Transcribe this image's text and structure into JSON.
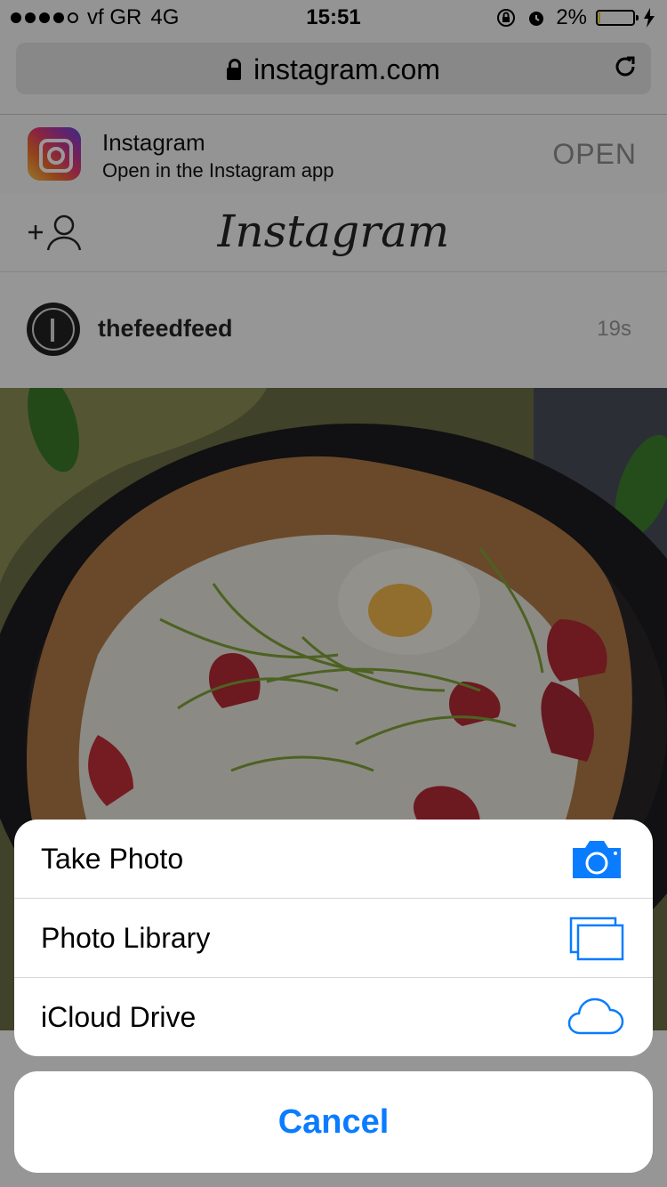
{
  "status_bar": {
    "carrier": "vf GR",
    "network": "4G",
    "time": "15:51",
    "battery": "2%"
  },
  "browser": {
    "url": "instagram.com"
  },
  "app_banner": {
    "title": "Instagram",
    "subtitle": "Open in the Instagram app",
    "open_label": "OPEN"
  },
  "ig_header": {
    "logo": "Instagram"
  },
  "post": {
    "username": "thefeedfeed",
    "time": "19s"
  },
  "action_sheet": {
    "items": [
      {
        "label": "Take Photo",
        "icon": "camera-icon"
      },
      {
        "label": "Photo Library",
        "icon": "photo-library-icon"
      },
      {
        "label": "iCloud Drive",
        "icon": "icloud-icon"
      }
    ],
    "cancel_label": "Cancel"
  },
  "colors": {
    "accent": "#0a7cff",
    "sheet_bg": "#ffffff",
    "overlay": "rgba(0,0,0,0.4)"
  }
}
